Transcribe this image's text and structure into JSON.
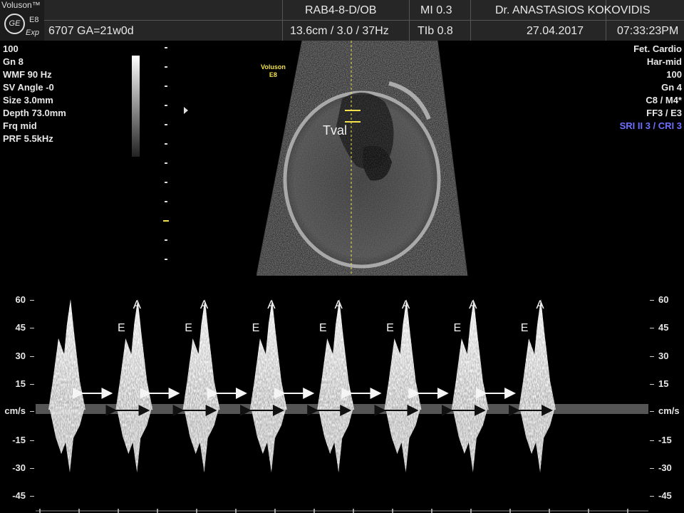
{
  "header": {
    "brand": "Voluson™",
    "logo_text": "GE",
    "model": "E8",
    "mode": "Exp",
    "patient": "6707  GA=21w0d",
    "probe": "RAB4-8-D/OB",
    "depth_freq": "13.6cm / 3.0 / 37Hz",
    "mi": "MI  0.3",
    "tib": "TIb  0.8",
    "doctor": "Dr. ANASTASIOS KOKOVIDIS",
    "date": "27.04.2017",
    "time": "07:33:23PM"
  },
  "left_params": [
    "100",
    "Gn  8",
    "WMF 90 Hz",
    "SV Angle -0",
    "Size  3.0mm",
    "Depth 73.0mm",
    "Frq mid",
    "PRF  5.5kHz"
  ],
  "right_params": [
    "Fet. Cardio",
    "Har-mid",
    "100",
    "Gn  4",
    "C8 / M4*",
    "FF3 / E3"
  ],
  "right_params_blue": "SRI II 3 / CRI 3",
  "image_label": {
    "line1": "Voluson",
    "line2": "E8"
  },
  "annotation": "Tval",
  "scale": {
    "labels": [
      "60",
      "45",
      "30",
      "15",
      "cm/s",
      "-15",
      "-30",
      "-45"
    ]
  },
  "waveform": {
    "unit": "cm/s",
    "peak_e_label": "E",
    "peak_a_label": "A",
    "cycles": 8,
    "colors": {
      "accent": "#f2e14c",
      "blue": "#6f6fff"
    }
  }
}
